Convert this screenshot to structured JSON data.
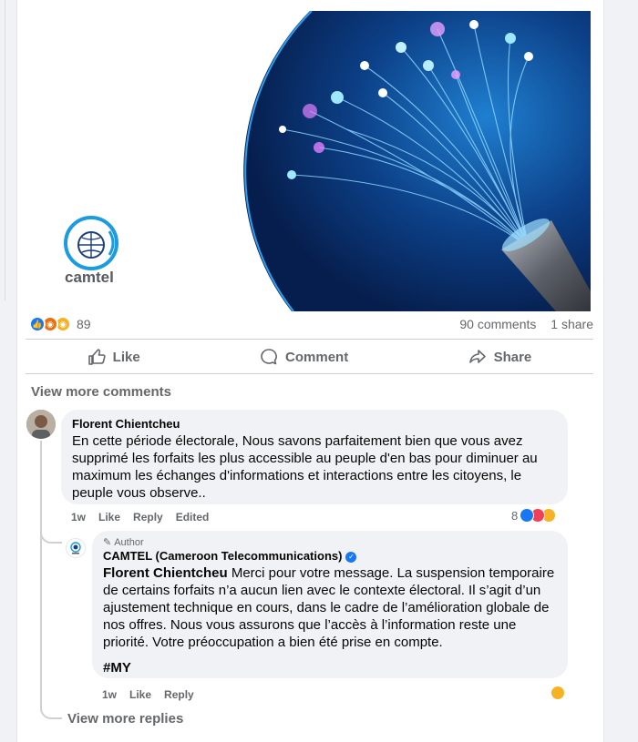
{
  "post": {
    "image_logo_text": "camtel",
    "reactions_count": "89",
    "comments_count": "90 comments",
    "shares_count": "1 share"
  },
  "actions": {
    "like": "Like",
    "comment": "Comment",
    "share": "Share"
  },
  "view_more_comments": "View more comments",
  "comments": [
    {
      "author": "Florent Chientcheu",
      "text": "En cette période électorale, Nous savons parfaitement bien que vous avez supprimé les forfaits les plus accessible au peuple d'en bas pour diminuer au maximum les échanges d'informations et interactions entre les citoyens, le peuple vous observe..",
      "time": "1w",
      "like": "Like",
      "reply": "Reply",
      "edited": "Edited",
      "reaction_count": "8"
    }
  ],
  "reply": {
    "author_tag": "Author",
    "author": "CAMTEL (Cameroon Telecommunications)",
    "mention": "Florent Chientcheu",
    "text": " Merci pour votre message. La suspension temporaire de certains forfaits n’a aucun lien avec le contexte électoral. Il s’agit d’un ajustement technique en cours, dans le cadre de l’amélioration globale de nos offres. Nous vous assurons que l’accès à l’information reste une priorité. Votre préoccupation a bien été prise en compte.",
    "hashtag": "#MY",
    "time": "1w",
    "like": "Like",
    "reply": "Reply"
  },
  "view_more_replies": "View more replies",
  "colors": {
    "accent": "#1877f2",
    "muted": "#65676b",
    "bubble": "#f0f2f5"
  }
}
